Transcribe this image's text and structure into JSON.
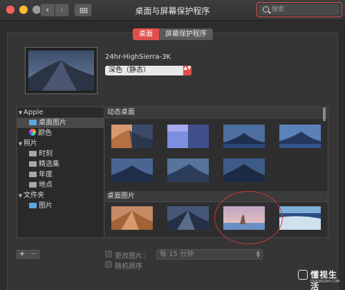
{
  "window": {
    "title": "桌面与屏幕保护程序",
    "back_glyph": "‹",
    "forward_glyph": "›",
    "search_placeholder": "搜索"
  },
  "tabs": {
    "desktop": "桌面",
    "screensaver": "屏幕保护程序",
    "active": "桌面"
  },
  "current": {
    "wallpaper_name": "24hr-HighSierra-3K",
    "mode_value": "深色（静态）",
    "mode_arrow": "▲▼"
  },
  "sidebar": {
    "groups": [
      {
        "label": "Apple",
        "expanded": true,
        "items": [
          {
            "label": "桌面图片",
            "icon": "folder-blue-icon",
            "selected": true
          },
          {
            "label": "颜色",
            "icon": "color-wheel-icon",
            "selected": false
          }
        ]
      },
      {
        "label": "照片",
        "expanded": true,
        "items": [
          {
            "label": "时刻",
            "icon": "folder-gray-icon"
          },
          {
            "label": "精选集",
            "icon": "folder-gray-icon"
          },
          {
            "label": "年度",
            "icon": "folder-gray-icon"
          },
          {
            "label": "地点",
            "icon": "folder-gray-icon"
          }
        ]
      },
      {
        "label": "文件夹",
        "expanded": true,
        "items": [
          {
            "label": "图片",
            "icon": "folder-blue-icon"
          }
        ]
      }
    ],
    "tri": "▼"
  },
  "sections": {
    "dynamic": "动态桌面",
    "pictures": "桌面图片"
  },
  "bottom": {
    "plus": "+",
    "minus": "−",
    "change_picture": "更改图片：",
    "interval": "每 15 分钟",
    "random_order": "随机顺序"
  },
  "watermark": {
    "text": "懂视生活",
    "sub": "DIDONGSHI.COM"
  },
  "colors": {
    "accent": "#e0504a",
    "window_bg": "#2c2c2c",
    "panel_bg": "#353535"
  }
}
